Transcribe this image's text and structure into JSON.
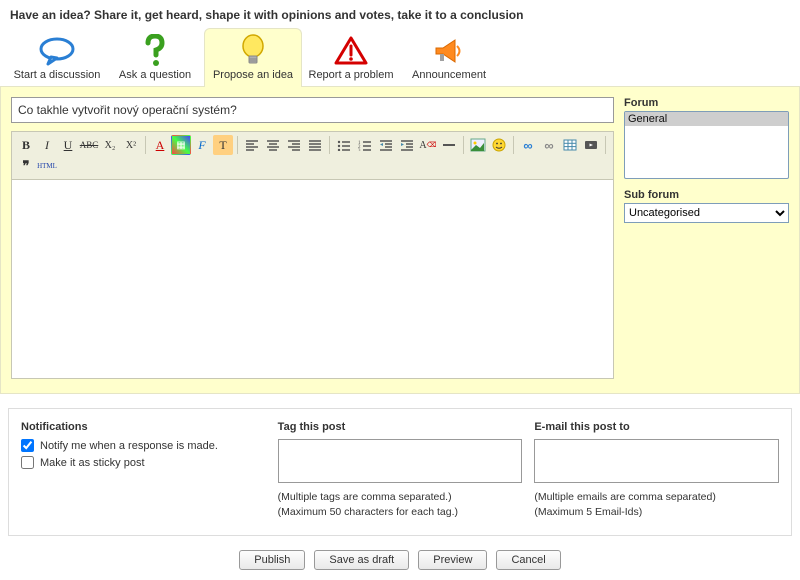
{
  "header": "Have an idea? Share it, get heard, shape it with opinions and votes, take it to a conclusion",
  "tabs": {
    "discussion": "Start a discussion",
    "question": "Ask a question",
    "idea": "Propose an idea",
    "problem": "Report a problem",
    "announcement": "Announcement"
  },
  "subject_value": "Co takhle vytvořit nový operační systém?",
  "toolbar": {
    "bold": "B",
    "italic": "I",
    "underline": "U",
    "strike": "ABC",
    "sub": "X₂",
    "sup": "X²",
    "fontcolor": "A",
    "bgcolor": "▦",
    "fontface": "F",
    "tt": "T",
    "alignleft": "≡",
    "aligncenter": "≡",
    "alignright": "≡",
    "alignfull": "≡",
    "ul": "•≡",
    "ol": "1≡",
    "outdent": "⇤",
    "indent": "⇥",
    "removeformat": "A",
    "hr": "—",
    "image": "▣",
    "smiley": "☺",
    "link": "⛓",
    "unlink": "⛓",
    "table": "▦",
    "video": "▶",
    "quote": "❝",
    "html": "HTML"
  },
  "right": {
    "forum_label": "Forum",
    "forum_options": [
      "General"
    ],
    "subforum_label": "Sub forum",
    "subforum_selected": "Uncategorised"
  },
  "lower": {
    "notifications_heading": "Notifications",
    "notify_label": "Notify me when a response is made.",
    "sticky_label": "Make it as sticky post",
    "tag_heading": "Tag this post",
    "tag_hint1": "(Multiple tags are comma separated.)",
    "tag_hint2": "(Maximum 50 characters for each tag.)",
    "email_heading": "E-mail this post to",
    "email_hint1": "(Multiple emails are comma separated)",
    "email_hint2": "(Maximum 5 Email-Ids)"
  },
  "buttons": {
    "publish": "Publish",
    "savedraft": "Save as draft",
    "preview": "Preview",
    "cancel": "Cancel"
  }
}
